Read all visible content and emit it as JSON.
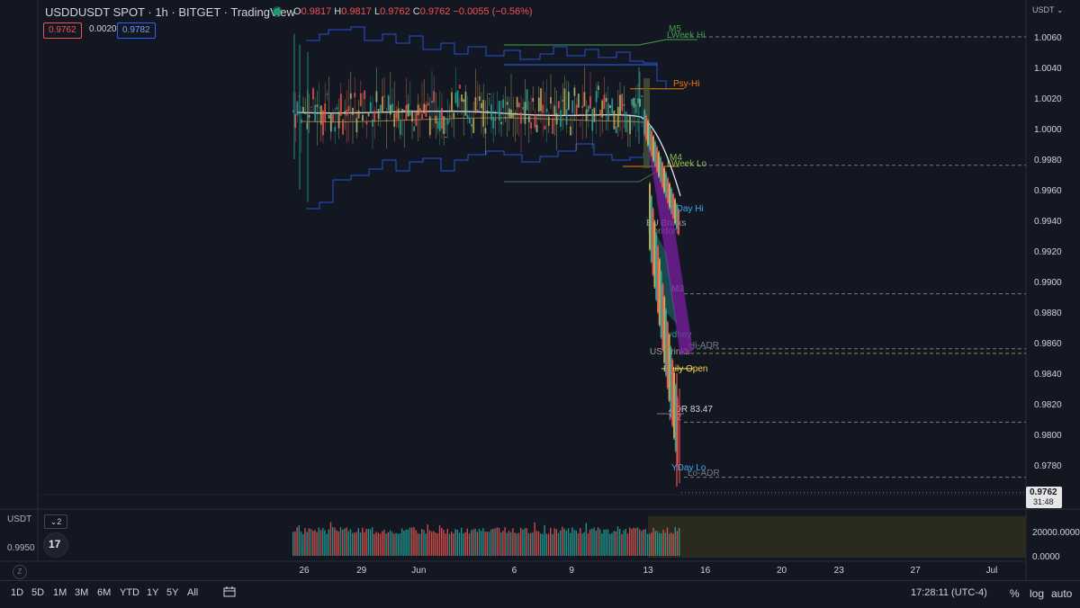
{
  "header": {
    "title": "USDDUSDT SPOT · 1h · BITGET · TradingView",
    "ohlc": {
      "o_label": "O",
      "o": "0.9817",
      "h_label": "H",
      "h": "0.9817",
      "l_label": "L",
      "l": "0.9762",
      "c_label": "C",
      "c": "0.9762",
      "change": "−0.0055 (−0.56%)"
    },
    "bid": "0.9762",
    "spread": "0.0020",
    "ask": "0.9782"
  },
  "axis": {
    "unit": "USDT",
    "price_ticks": [
      "1.0060",
      "1.0040",
      "1.0020",
      "1.0000",
      "0.9980",
      "0.9960",
      "0.9940",
      "0.9920",
      "0.9900",
      "0.9880",
      "0.9860",
      "0.9840",
      "0.9820",
      "0.9800",
      "0.9780"
    ],
    "date_ticks": [
      "26",
      "29",
      "Jun",
      "6",
      "9",
      "13",
      "16",
      "20",
      "23",
      "27",
      "Jul"
    ],
    "last_price": "0.9762",
    "countdown": "31:48"
  },
  "volume_pane": {
    "label": "USDT",
    "count": "2",
    "price": "0.9950",
    "ticks": [
      "20000.0000",
      "10000.0000",
      "0.0000"
    ]
  },
  "levels": [
    {
      "label": "M5",
      "color": "#43a047"
    },
    {
      "label": "LWeek Hi",
      "color": "#43a047"
    },
    {
      "label": "Psy-Hi",
      "color": "#f57c00"
    },
    {
      "label": "M4",
      "color": "#8bc34a"
    },
    {
      "label": "LWeek Lo",
      "color": "#8bc34a"
    },
    {
      "label": "YDay Hi",
      "color": "#42a5f5"
    },
    {
      "label": "EU Brinks",
      "color": "#9e9e9e"
    },
    {
      "label": "London",
      "color": "#787b86"
    },
    {
      "label": "M3",
      "color": "#b2b5be"
    },
    {
      "label": "Sydney",
      "color": "#26a69a"
    },
    {
      "label": "Hi-ADR",
      "color": "#787b86"
    },
    {
      "label": "US Brinks",
      "color": "#9e9e9e"
    },
    {
      "label": "Daily Open",
      "color": "#ffd54f"
    },
    {
      "label": "ADR 83.47",
      "color": "#d1d4dc"
    },
    {
      "label": "M2",
      "color": "#b2b5be"
    },
    {
      "label": "YDay Lo",
      "color": "#42a5f5"
    },
    {
      "label": "Lo-ADR",
      "color": "#787b86"
    }
  ],
  "chart_data": {
    "type": "candlestick",
    "symbol": "USDDUSDT",
    "interval": "1h",
    "x_range": [
      "May 25",
      "Jul 1"
    ],
    "ylim": [
      0.9765,
      1.0065
    ],
    "regime": [
      {
        "phase": "range",
        "from": "May 25",
        "to": "Jun 12",
        "low": 0.9975,
        "high": 1.004,
        "mean": 1.001
      },
      {
        "phase": "drop",
        "from": "Jun 13",
        "to": "Jun 14",
        "start": 1.001,
        "end": 0.9762
      }
    ],
    "levels": {
      "M5": 1.0062,
      "LWeek Hi": 1.006,
      "Psy-Hi": 1.0026,
      "M4": 0.9978,
      "LWeek Lo": 0.9976,
      "YDay Hi": 0.9951,
      "M3": 0.9892,
      "Hi-ADR": 0.9856,
      "US Brinks": 0.9853,
      "Daily Open": 0.9843,
      "ADR": 83.47,
      "M2": 0.9808,
      "YDay Lo": 0.9775,
      "Lo-ADR": 0.9772
    },
    "last": {
      "open": 0.9817,
      "high": 0.9817,
      "low": 0.9762,
      "close": 0.9762,
      "change": -0.0055,
      "change_pct": -0.56
    },
    "grid": false
  },
  "bottom": {
    "timeframes": [
      "1D",
      "5D",
      "1M",
      "3M",
      "6M",
      "YTD",
      "1Y",
      "5Y",
      "All"
    ],
    "clock": "17:28:11 (UTC-4)",
    "pct": "%",
    "log": "log",
    "auto": "auto"
  }
}
